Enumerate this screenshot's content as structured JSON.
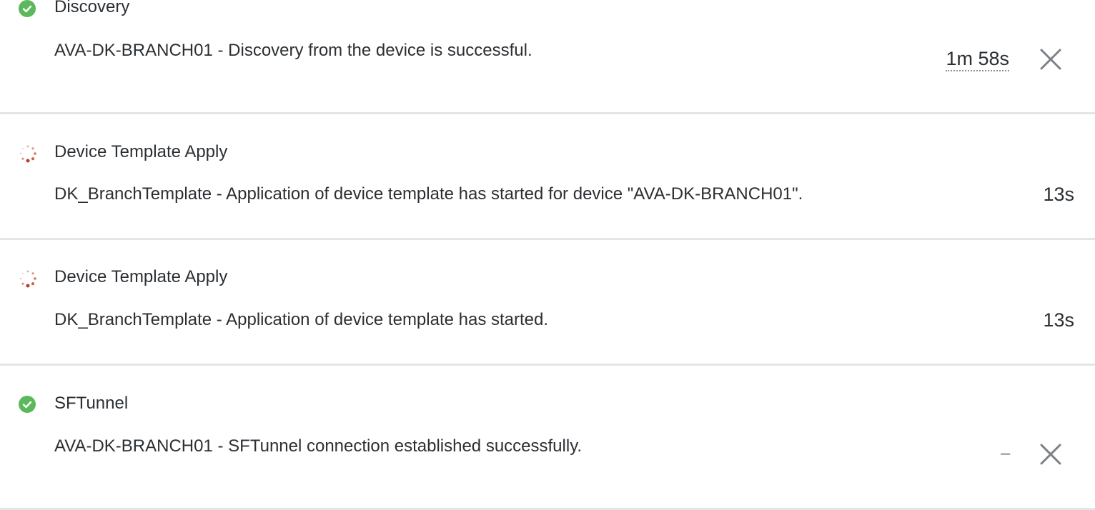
{
  "tasks": [
    {
      "status": "success",
      "status_icon": "check-circle-icon",
      "title": "Discovery",
      "message": "AVA-DK-BRANCH01 - Discovery from the device is successful.",
      "duration": "1m 58s",
      "dismissible": true
    },
    {
      "status": "in-progress",
      "status_icon": "spinner-icon",
      "title": "Device Template Apply",
      "message": "DK_BranchTemplate - Application of device template has started for device \"AVA-DK-BRANCH01\".",
      "duration": "13s",
      "dismissible": false
    },
    {
      "status": "in-progress",
      "status_icon": "spinner-icon",
      "title": "Device Template Apply",
      "message": "DK_BranchTemplate - Application of device template has started.",
      "duration": "13s",
      "dismissible": false
    },
    {
      "status": "success",
      "status_icon": "check-circle-icon",
      "title": "SFTunnel",
      "message": "AVA-DK-BRANCH01 - SFTunnel connection established successfully.",
      "duration": "–",
      "dismissible": true
    }
  ],
  "colors": {
    "success": "#5cb85c",
    "spinner": "#c0392b",
    "divider": "#e4e5e7",
    "text": "#2b2f33",
    "close_icon": "#7b8187"
  }
}
